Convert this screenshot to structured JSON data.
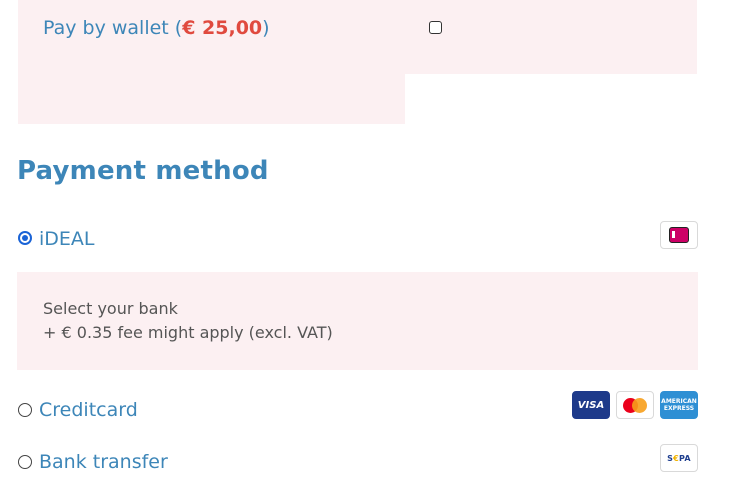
{
  "wallet": {
    "label_prefix": "Pay by wallet (",
    "amount": "€ 25,00",
    "label_suffix": ")",
    "checked": false
  },
  "payment": {
    "title": "Payment method",
    "options": [
      {
        "label": "iDEAL",
        "selected": true,
        "logo": "ideal-logo",
        "details": {
          "line1": "Select your bank",
          "line2": "+ € 0.35 fee might apply (excl. VAT)"
        }
      },
      {
        "label": "Creditcard",
        "selected": false,
        "logos": {
          "visa": "VISA",
          "mastercard": "mastercard-logo",
          "amex_line1": "AMERICAN",
          "amex_line2": "EXPRESS"
        }
      },
      {
        "label": "Bank transfer",
        "selected": false,
        "logos": {
          "sepa_left": "S",
          "sepa_star": "€",
          "sepa_right": "PA"
        }
      }
    ]
  },
  "colors": {
    "accent_blue": "#3d86b8",
    "amount_red": "#e04a3f",
    "panel_pink": "#fcf0f2",
    "radio_blue": "#1a63d6"
  }
}
